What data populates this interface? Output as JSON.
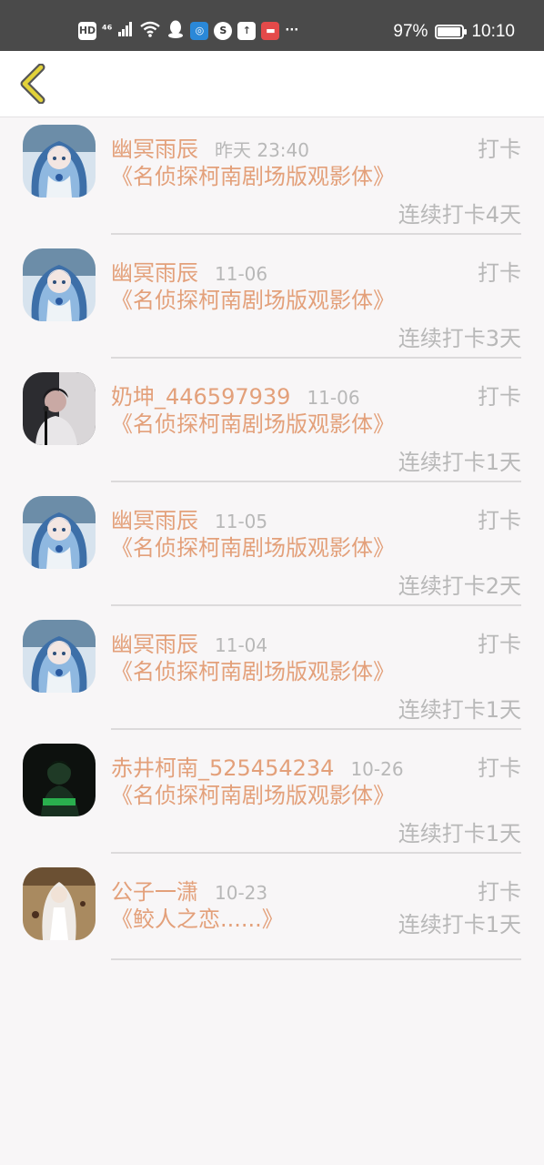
{
  "status_bar": {
    "icons": [
      "HD",
      "4G",
      "signal-icon",
      "wifi-icon",
      "qq-icon",
      "app-icon",
      "sogou-icon",
      "upload-icon",
      "app-red-icon",
      "more-icon"
    ],
    "hd": "HD",
    "net": "⁴⁶",
    "more": "···",
    "battery_percent": "97%",
    "battery_level": 0.97,
    "time": "10:10"
  },
  "header": {
    "back_icon": "chevron-left-icon",
    "accent_color": "#e2d23a"
  },
  "colors": {
    "accent": "#e3a07a",
    "muted": "#b8b8b8"
  },
  "items": [
    {
      "name": "幽冥雨辰",
      "time": "昨天 23:40",
      "action": "打卡",
      "title": "《名侦探柯南剧场版观影体》",
      "streak": "连续打卡4天",
      "avatar": "anime-blue"
    },
    {
      "name": "幽冥雨辰",
      "time": "11-06",
      "action": "打卡",
      "title": "《名侦探柯南剧场版观影体》",
      "streak": "连续打卡3天",
      "avatar": "anime-blue"
    },
    {
      "name": "奶坤_446597939",
      "time": "11-06",
      "action": "打卡",
      "title": "《名侦探柯南剧场版观影体》",
      "streak": "连续打卡1天",
      "avatar": "singer"
    },
    {
      "name": "幽冥雨辰",
      "time": "11-05",
      "action": "打卡",
      "title": "《名侦探柯南剧场版观影体》",
      "streak": "连续打卡2天",
      "avatar": "anime-blue"
    },
    {
      "name": "幽冥雨辰",
      "time": "11-04",
      "action": "打卡",
      "title": "《名侦探柯南剧场版观影体》",
      "streak": "连续打卡1天",
      "avatar": "anime-blue"
    },
    {
      "name": "赤井柯南_525454234",
      "time": "10-26",
      "action": "打卡",
      "title": "《名侦探柯南剧场版观影体》",
      "streak": "连续打卡1天",
      "avatar": "dark-green"
    },
    {
      "name": "公子一潇",
      "time": "10-23",
      "action": "打卡",
      "title": "《鲛人之恋......》",
      "streak": "连续打卡1天",
      "avatar": "white-hair"
    }
  ]
}
